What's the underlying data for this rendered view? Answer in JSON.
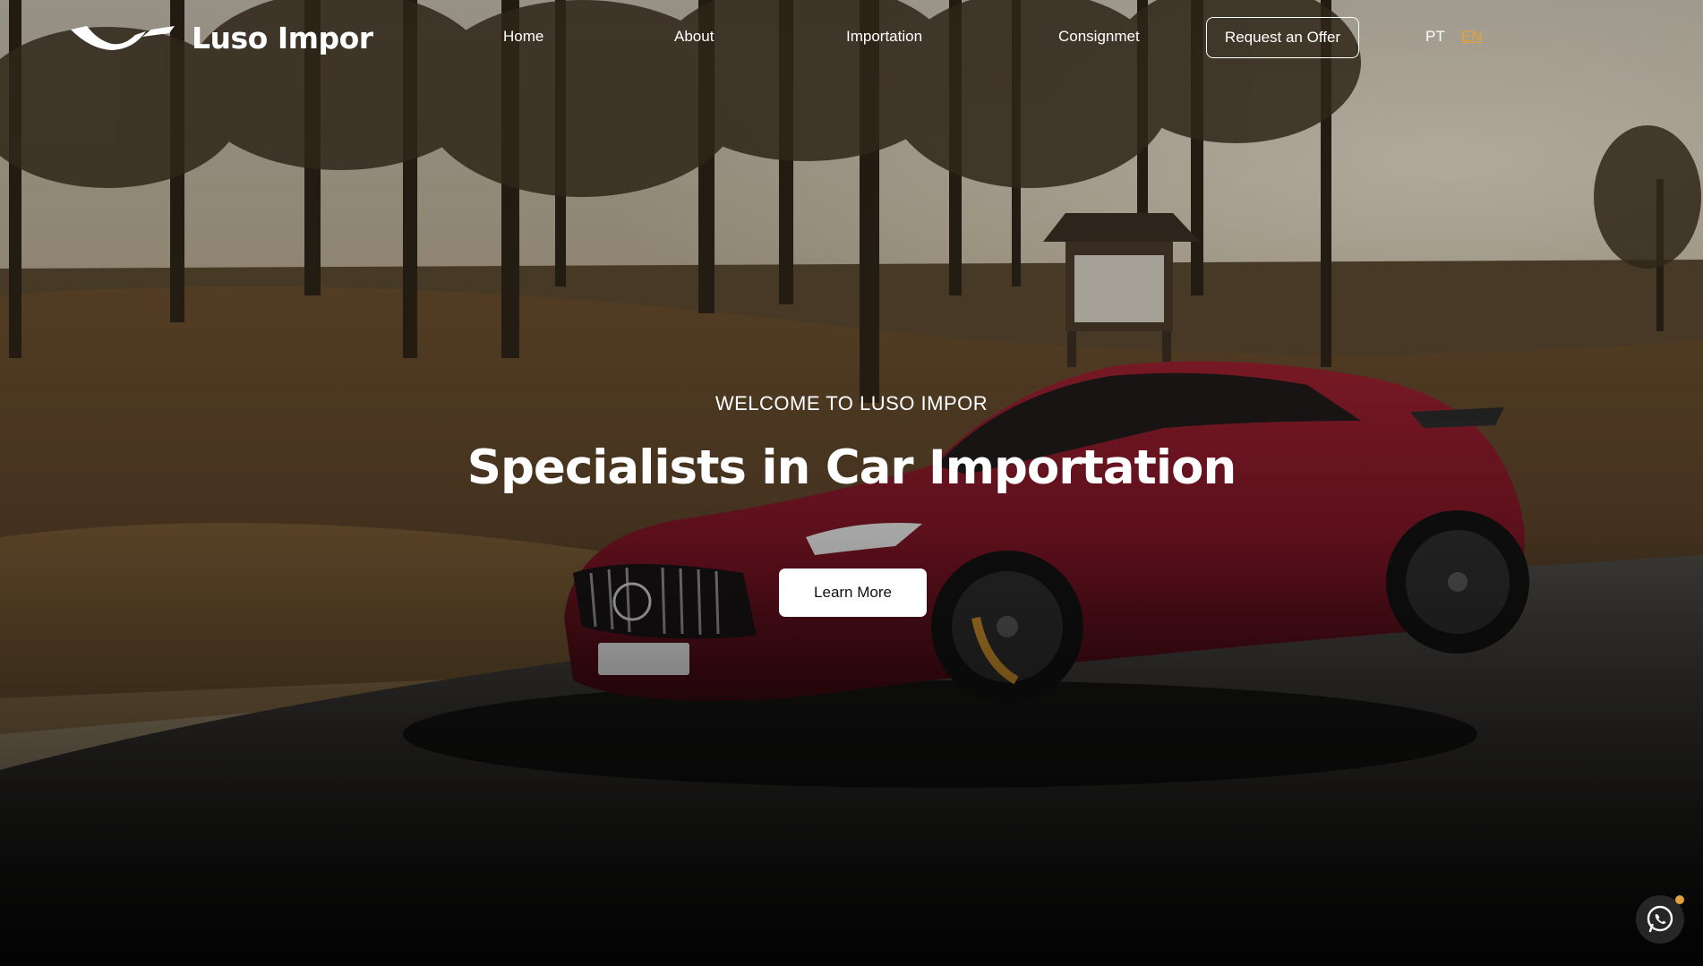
{
  "brand": {
    "name": "Luso Impor",
    "logo_icon": "luso-impor-logo-mark"
  },
  "nav": {
    "items": [
      {
        "label": "Home"
      },
      {
        "label": "About"
      },
      {
        "label": "Importation"
      },
      {
        "label": "Consignmet"
      }
    ],
    "cta_label": "Request an Offer",
    "languages": [
      {
        "label": "PT",
        "active": false
      },
      {
        "label": "EN",
        "active": true
      }
    ]
  },
  "hero": {
    "eyebrow": "WELCOME TO LUSO IMPOR",
    "headline": "Specialists in Car Importation",
    "button_label": "Learn More",
    "background_icon": "red-sports-car-forest-photo"
  },
  "whatsapp": {
    "icon": "whatsapp-icon",
    "has_notification": true
  },
  "colors": {
    "accent": "#e2a33b",
    "text": "#ffffff",
    "button_bg": "#ffffff",
    "car_red": "#7a1420"
  }
}
